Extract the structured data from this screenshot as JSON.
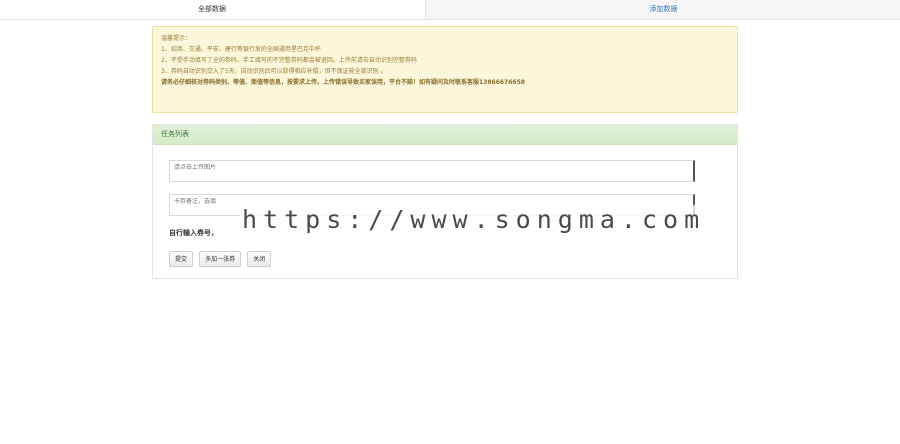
{
  "top_tabs": [
    {
      "label": "全部数据"
    },
    {
      "label": "添加数据"
    }
  ],
  "notice": {
    "lines": [
      {
        "text": "温馨提示：",
        "bold": false
      },
      {
        "text": "1、招商、交通、平安、建行等银行发的全国通用星巴克中杯",
        "bold": false
      },
      {
        "text": " 2、不受手动填写了全的券码，手工填写的不完整券码都会被退回。上传前请去自动识别完整券码",
        "bold": false
      },
      {
        "text": "3、券码自动识别交入了5天，自动识别后可以获得相应补偿，但不保证能全部识别 。",
        "bold": false
      },
      {
        "text": "请务必仔细核对券码类别、等值、面值等信息，按要求上传。上传错误导致买家误用，平台不赔！如有疑问及时联系客服13866676658",
        "bold": true
      }
    ]
  },
  "panel": {
    "title": "任务列表",
    "upload_placeholder": "请点击上传图片",
    "remark_placeholder": "卡券备注，选填",
    "manual_label": "自行输入券号，",
    "buttons": {
      "submit": "提交",
      "add_more": "多加一张券",
      "close": "关闭"
    }
  },
  "watermark": "https://www.songma.com"
}
